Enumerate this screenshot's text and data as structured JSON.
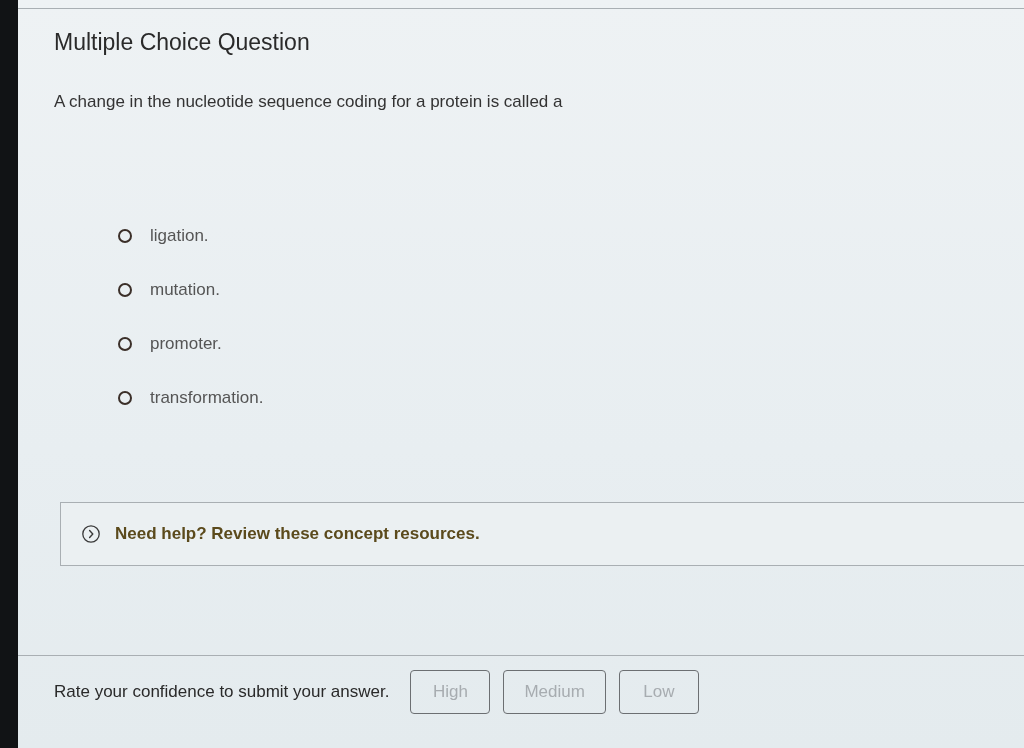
{
  "title": "Multiple Choice Question",
  "question": "A change in the nucleotide sequence coding for a protein is called a",
  "options": [
    {
      "label": "ligation.",
      "selected": false
    },
    {
      "label": "mutation.",
      "selected": false
    },
    {
      "label": "promoter.",
      "selected": false
    },
    {
      "label": "transformation.",
      "selected": false
    }
  ],
  "help": {
    "label": "Need help? Review these concept resources.",
    "expanded": false
  },
  "confidence": {
    "prompt": "Rate your confidence to submit your answer.",
    "buttons": [
      {
        "label": "High",
        "disabled": true
      },
      {
        "label": "Medium",
        "disabled": true
      },
      {
        "label": "Low",
        "disabled": true
      }
    ]
  }
}
